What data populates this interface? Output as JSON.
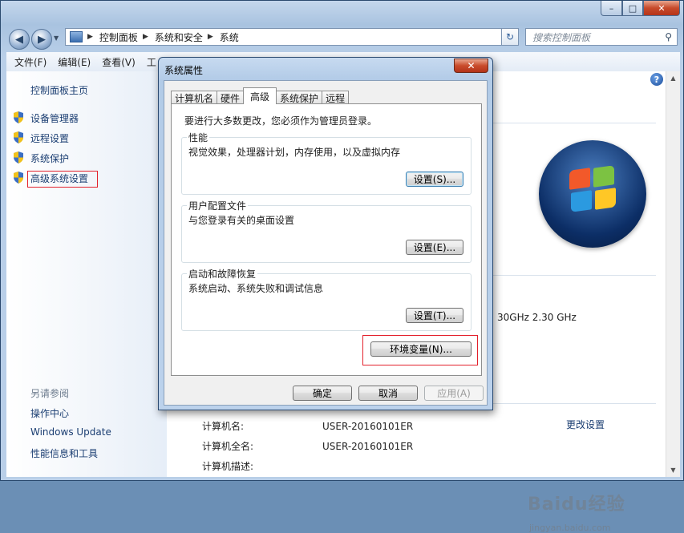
{
  "window": {
    "caption": {
      "min": "–",
      "max": "□",
      "close": "✕"
    },
    "address": {
      "parts": [
        "控制面板",
        "系统和安全",
        "系统"
      ]
    },
    "search_placeholder": "搜索控制面板",
    "menu": [
      "文件(F)",
      "编辑(E)",
      "查看(V)",
      "工"
    ]
  },
  "sidebar": {
    "home": "控制面板主页",
    "items": [
      {
        "label": "设备管理器",
        "icon": "shield-icon"
      },
      {
        "label": "远程设置",
        "icon": "shield-icon"
      },
      {
        "label": "系统保护",
        "icon": "shield-icon"
      },
      {
        "label": "高级系统设置",
        "icon": "shield-icon"
      }
    ],
    "see_also_title": "另请参阅",
    "see_also": [
      "操作中心",
      "Windows Update",
      "性能信息和工具"
    ]
  },
  "main": {
    "cpu_speed_partial": "30GHz   2.30 GHz",
    "computer_name_label": "计算机名:",
    "computer_name_value": "USER-20160101ER",
    "full_name_label": "计算机全名:",
    "full_name_value": "USER-20160101ER",
    "description_label": "计算机描述:",
    "change_settings": "更改设置",
    "watermark": "Baidu经验",
    "watermark_url": "jingyan.baidu.com"
  },
  "dialog": {
    "title": "系统属性",
    "tabs": [
      "计算机名",
      "硬件",
      "高级",
      "系统保护",
      "远程"
    ],
    "active_tab": "高级",
    "admin_note": "要进行大多数更改，您必须作为管理员登录。",
    "groups": [
      {
        "title": "性能",
        "desc": "视觉效果，处理器计划，内存使用，以及虚拟内存",
        "button": "设置(S)..."
      },
      {
        "title": "用户配置文件",
        "desc": "与您登录有关的桌面设置",
        "button": "设置(E)..."
      },
      {
        "title": "启动和故障恢复",
        "desc": "系统启动、系统失败和调试信息",
        "button": "设置(T)..."
      }
    ],
    "env_button": "环境变量(N)...",
    "ok": "确定",
    "cancel": "取消",
    "apply": "应用(A)"
  }
}
